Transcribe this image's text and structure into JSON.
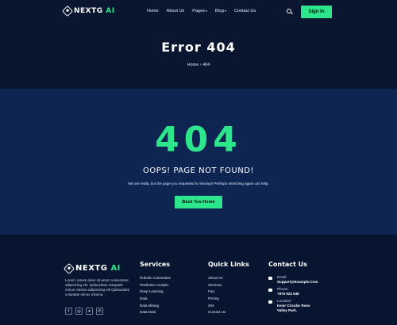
{
  "brand": {
    "name": "NEXTG",
    "accent_word": "AI",
    "accent_color": "#2de58a",
    "bg_color": "#0a1530"
  },
  "nav": {
    "items": [
      {
        "label": "Home"
      },
      {
        "label": "About Us"
      },
      {
        "label": "Pages",
        "has_dropdown": true
      },
      {
        "label": "Blog",
        "has_dropdown": true
      },
      {
        "label": "Contact Us"
      }
    ],
    "search_icon": "search-icon",
    "signin_label": "Sign In"
  },
  "page_header": {
    "title": "Error 404",
    "breadcrumb": {
      "home": "Home",
      "separator": "›",
      "current": "404"
    }
  },
  "error": {
    "code": "404",
    "heading": "OOPS! PAGE NOT FOUND!",
    "message": "We are really, but the page you requested is missing!! Perhaps searching again can help.",
    "button_label": "Back Too Home"
  },
  "footer": {
    "about": "Lorem, ipsum dolor sit amet consectetur adipisicing elit. Quibusdam voluptate minus minima adipisicing elit Quibusdam voluptate minus minima.",
    "socials": [
      {
        "icon": "facebook-icon",
        "glyph": "f"
      },
      {
        "icon": "instagram-icon",
        "glyph": "◎"
      },
      {
        "icon": "twitter-icon",
        "glyph": "✦"
      },
      {
        "icon": "whatsapp-icon",
        "glyph": "✆"
      }
    ],
    "services_title": "Services",
    "services": [
      "Robotic Automation",
      "Predictive Analytic",
      "Deep Learning",
      "Data",
      "Data Mining",
      "Data Data"
    ],
    "quick_title": "Quick Links",
    "quick_links": [
      "About Us",
      "Services",
      "Faq",
      "Pricing",
      "404",
      "Contact Us"
    ],
    "contact_title": "Contact Us",
    "contact": {
      "email_label": "Email:",
      "email": "Support@Example.Com",
      "phone_label": "Phone:",
      "phone": "+875 624 548",
      "location_label": "Location:",
      "location_line1": "Inner Circular Ross",
      "location_line2": "Valley Park."
    }
  }
}
